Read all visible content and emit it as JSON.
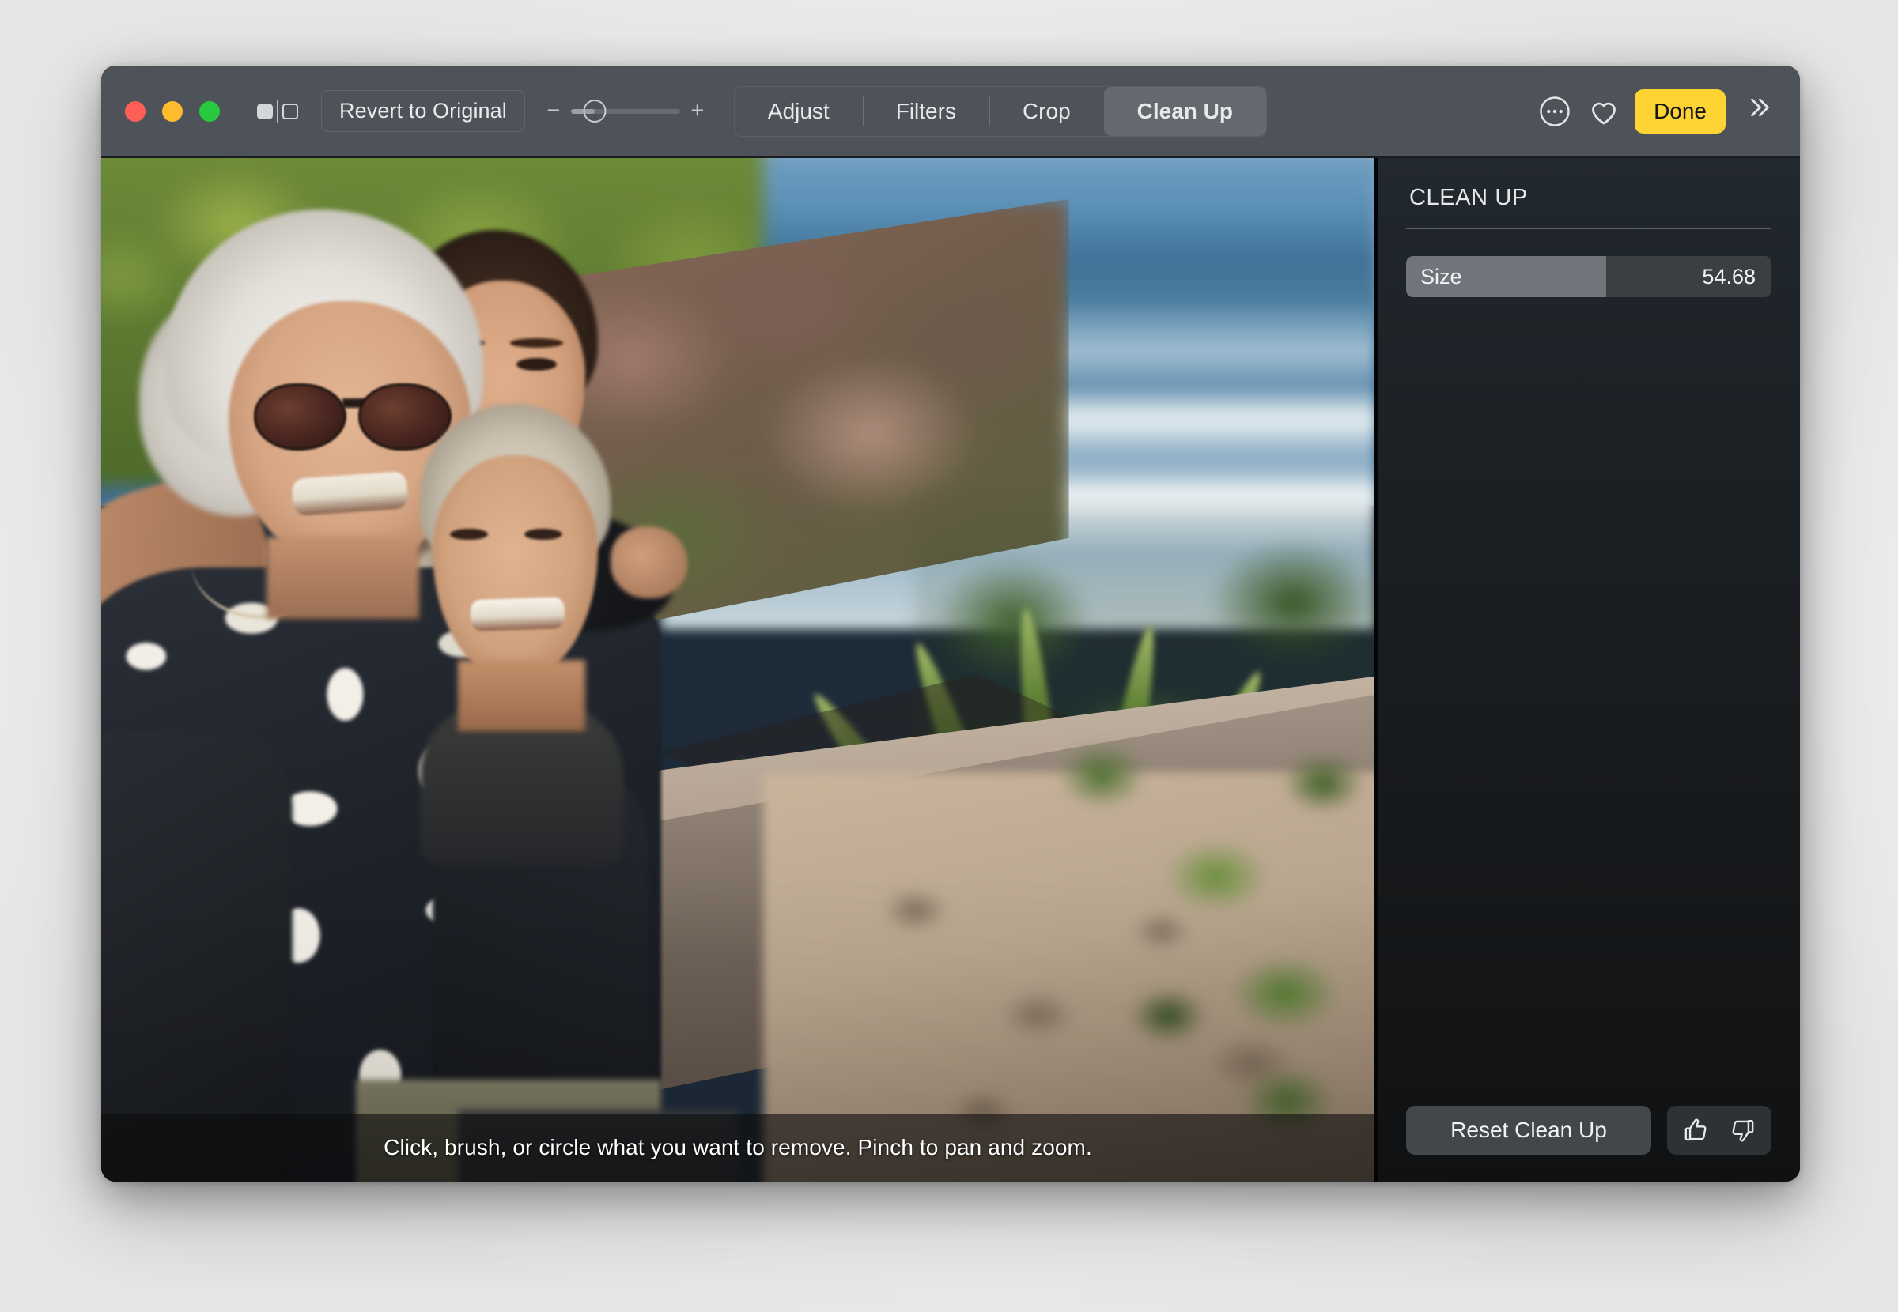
{
  "window": {
    "traffic_lights": [
      {
        "name": "close",
        "color": "#ff5f57"
      },
      {
        "name": "minimize",
        "color": "#febc2e"
      },
      {
        "name": "zoom",
        "color": "#28c840"
      }
    ]
  },
  "toolbar": {
    "compare_icon": "compare-before-after-icon",
    "revert_label": "Revert to Original",
    "zoom_minus": "−",
    "zoom_plus": "+",
    "zoom_value_percent": 22,
    "tabs": [
      {
        "label": "Adjust",
        "active": false
      },
      {
        "label": "Filters",
        "active": false
      },
      {
        "label": "Crop",
        "active": false
      },
      {
        "label": "Clean Up",
        "active": true
      }
    ],
    "more_icon": "ellipsis-circle-icon",
    "favorite_icon": "heart-icon",
    "done_label": "Done",
    "done_color": "#fdd434",
    "overflow_icon": "double-chevron-right-icon"
  },
  "canvas": {
    "hint": "Click, brush, or circle what you want to remove. Pinch to pan and zoom.",
    "photo_alt": "Three smiling women posing together outdoors by the ocean with agave plants and a stone wall"
  },
  "sidebar": {
    "title": "CLEAN UP",
    "size": {
      "label": "Size",
      "value": "54.68",
      "fill_percent": 54.68
    },
    "reset_label": "Reset Clean Up",
    "thumbs_up_icon": "thumbs-up-icon",
    "thumbs_down_icon": "thumbs-down-icon"
  }
}
